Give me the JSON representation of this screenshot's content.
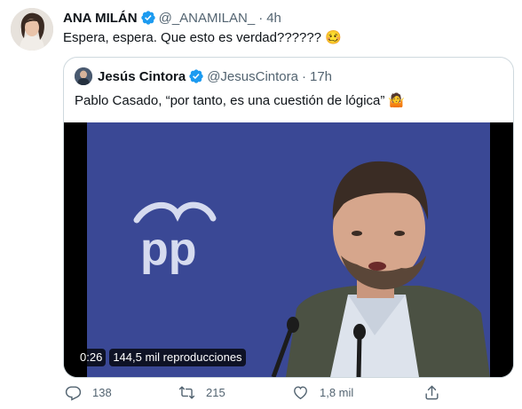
{
  "tweet": {
    "author_name": "ANA MILÁN",
    "author_handle": "@_ANAMILAN_",
    "separator": "·",
    "time": "4h",
    "text": "Espera, espera. Que esto es verdad??????",
    "emoji": "🥴",
    "avatar_icon": "profile-photo"
  },
  "quote": {
    "author_name": "Jesús Cintora",
    "author_handle": "@JesusCintora",
    "separator": "·",
    "time": "17h",
    "text": "Pablo Casado, “por tanto, es una cuestión de lógica”",
    "emoji": "🤷",
    "video": {
      "duration": "0:26",
      "views": "144,5 mil reproducciones",
      "logo_text": "pp"
    }
  },
  "actions": {
    "reply_count": "138",
    "retweet_count": "215",
    "like_count": "1,8 mil"
  },
  "colors": {
    "verified": "#1d9bf0",
    "muted_text": "#536471",
    "border": "#cfd9de",
    "video_bg": "#3e4c9a"
  }
}
